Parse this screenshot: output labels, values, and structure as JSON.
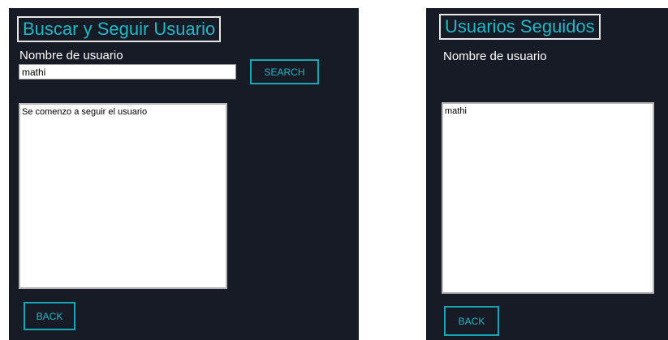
{
  "search_panel": {
    "title": "Buscar y Seguir Usuario",
    "username_label": "Nombre de usuario",
    "username_value": "mathi",
    "search_button": "SEARCH",
    "results": [
      "Se comenzo a seguir el usuario"
    ],
    "back_button": "BACK"
  },
  "followed_panel": {
    "title": "Usuarios Seguidos",
    "username_label": "Nombre de usuario",
    "users": [
      "mathi"
    ],
    "back_button": "BACK"
  },
  "colors": {
    "panel_background": "#161b26",
    "accent": "#22b8c8",
    "button_border": "#1aa6b4",
    "title_border": "#e6e6e6"
  }
}
